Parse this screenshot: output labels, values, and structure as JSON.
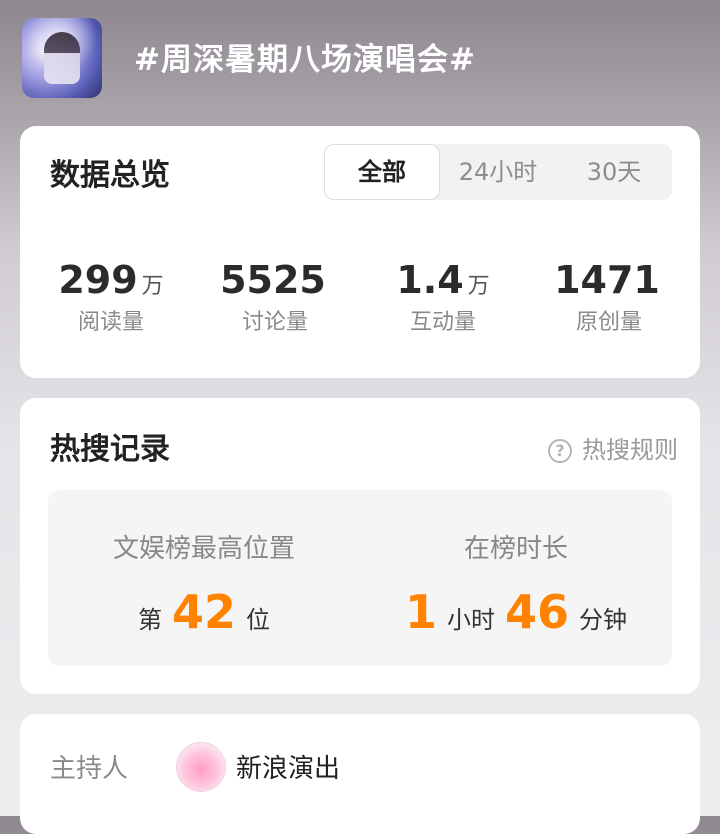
{
  "header": {
    "title": "#周深暑期八场演唱会#"
  },
  "overview": {
    "title": "数据总览",
    "tabs": [
      "全部",
      "24小时",
      "30天"
    ],
    "active_tab": "全部",
    "stats": [
      {
        "value": "299",
        "unit": "万",
        "label": "阅读量"
      },
      {
        "value": "5525",
        "unit": "",
        "label": "讨论量"
      },
      {
        "value": "1.4",
        "unit": "万",
        "label": "互动量"
      },
      {
        "value": "1471",
        "unit": "",
        "label": "原创量"
      }
    ]
  },
  "hot": {
    "title": "热搜记录",
    "rule_label": "热搜规则",
    "rank": {
      "head": "文娱榜最高位置",
      "prefix": "第",
      "value": "42",
      "suffix": "位"
    },
    "duration": {
      "head": "在榜时长",
      "hours": "1",
      "hours_unit": "小时",
      "minutes": "46",
      "minutes_unit": "分钟"
    }
  },
  "host": {
    "label": "主持人",
    "name": "新浪演出"
  },
  "colors": {
    "accent": "#ff8200"
  }
}
